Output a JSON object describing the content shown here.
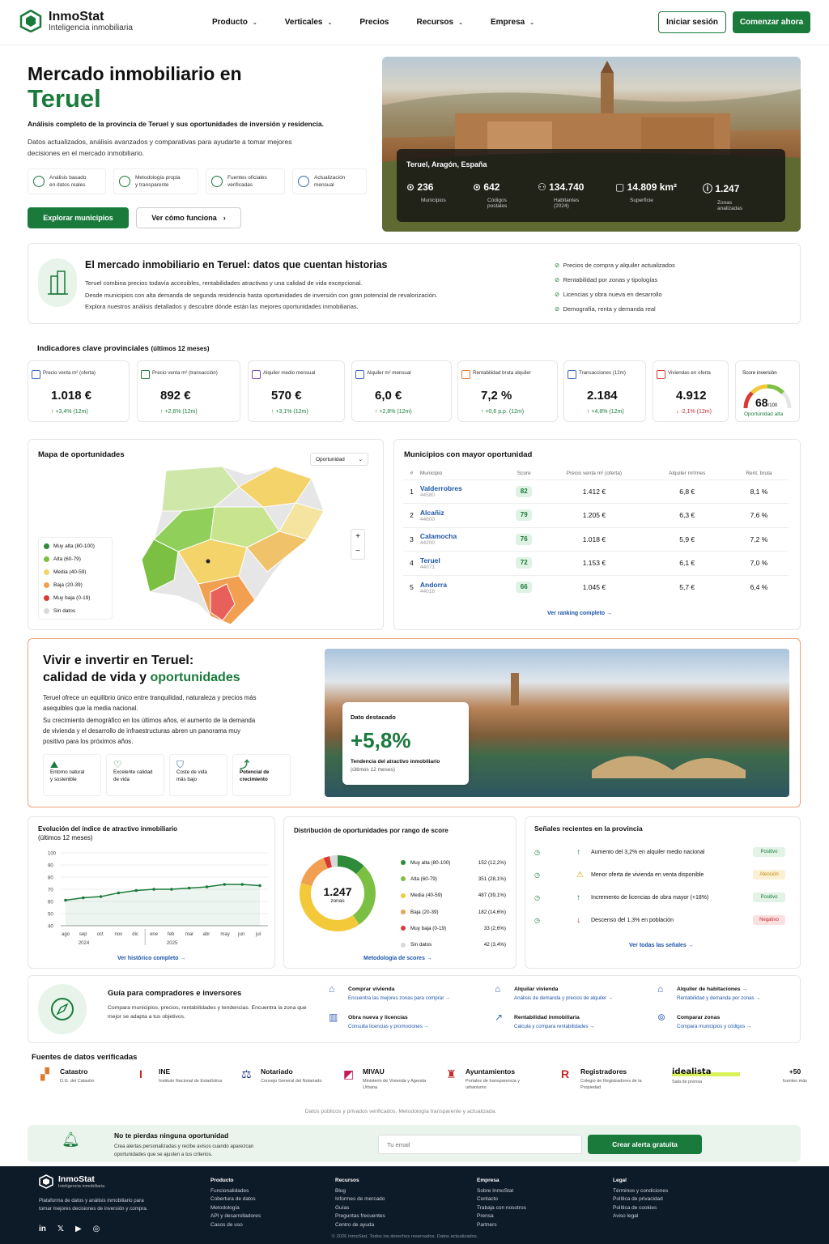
{
  "header": {
    "brand": "InmoStat",
    "tagline": "Inteligencia inmobiliaria",
    "nav": [
      "Producto",
      "Verticales",
      "Precios",
      "Recursos",
      "Empresa"
    ],
    "login": "Iniciar sesión",
    "cta": "Comenzar ahora"
  },
  "hero": {
    "title_line1": "Mercado inmobiliario en",
    "title_line2": "Teruel",
    "lead": "Análisis completo de la provincia de Teruel y sus oportunidades de inversión y residencia.",
    "desc": "Datos actualizados, análisis avanzados y comparativas para ayudarte a tomar mejores decisiones en el mercado inmobiliario.",
    "features": [
      {
        "t1": "Análisis basado",
        "t2": "en datos reales"
      },
      {
        "t1": "Metodología propia",
        "t2": "y transparente"
      },
      {
        "t1": "Fuentes oficiales",
        "t2": "verificadas"
      },
      {
        "t1": "Actualización",
        "t2": "mensual"
      }
    ],
    "btn_primary": "Explorar municipios",
    "btn_secondary": "Ver cómo funciona",
    "location": "Teruel, Aragón, España",
    "stats": [
      {
        "v": "236",
        "l": "Municipios"
      },
      {
        "v": "642",
        "l": "Códigos postales"
      },
      {
        "v": "134.740",
        "l": "Habitantes (2024)"
      },
      {
        "v": "14.809 km²",
        "l": "Superficie"
      },
      {
        "v": "1.247",
        "l": "Zonas analizadas"
      }
    ]
  },
  "intro": {
    "title": "El mercado inmobiliario en Teruel: datos que cuentan historias",
    "p1": "Teruel combina precios todavía accesibles, rentabilidades atractivas y una calidad de vida excepcional.",
    "p2": "Desde municipios con alta demanda de segunda residencia hasta oportunidades de inversión con gran potencial de revalorización.",
    "p3": "Explora nuestros análisis detallados y descubre dónde están las mejores oportunidades inmobiliarias.",
    "checks": [
      "Precios de compra y alquiler actualizados",
      "Rentabilidad por zonas y tipologías",
      "Licencias y obra nueva en desarrollo",
      "Demografía, renta y demanda real"
    ]
  },
  "kpis": {
    "title": "Indicadores clave provinciales",
    "period": "(últimos 12 meses)",
    "items": [
      {
        "t": "Precio venta m² (oferta)",
        "v": "1.018 €",
        "c": "↑ +3,4% (12m)"
      },
      {
        "t": "Precio venta m² (transacción)",
        "v": "892 €",
        "c": "↑ +2,6% (12m)"
      },
      {
        "t": "Alquiler medio mensual",
        "v": "570 €",
        "c": "↑ +3,1% (12m)"
      },
      {
        "t": "Alquiler m² mensual",
        "v": "6,0 €",
        "c": "↑ +2,8% (12m)"
      },
      {
        "t": "Rentabilidad bruta alquiler",
        "v": "7,2 %",
        "c": "↑ +0,6 p.p. (12m)"
      },
      {
        "t": "Transacciones (12m)",
        "v": "2.184",
        "c": "↑ +4,8% (12m)"
      },
      {
        "t": "Viviendas en oferta",
        "v": "4.912",
        "c": "↓ -2,1% (12m)"
      }
    ],
    "score_title": "Score inversión",
    "score": "68",
    "score_max": "/100",
    "score_label": "Oportunidad alta"
  },
  "map": {
    "title": "Mapa de oportunidades",
    "select": "Oportunidad",
    "legend": [
      "Muy alta (80-100)",
      "Alta (60-79)",
      "Media (40-59)",
      "Baja (20-39)",
      "Muy baja (0-19)",
      "Sin datos"
    ],
    "legend_colors": [
      "#2e8b3a",
      "#7cc043",
      "#f3d36a",
      "#f0a050",
      "#d93a35",
      "#d9d9d9"
    ]
  },
  "ranking": {
    "title": "Municipios con mayor oportunidad",
    "cols": [
      "#",
      "Municipio",
      "Score",
      "Precio venta m² (oferta)",
      "Alquiler m²/mes",
      "Rent. bruta"
    ],
    "rows": [
      {
        "n": "1",
        "name": "Valderrobres",
        "zip": "44580",
        "score": "82",
        "price": "1.412 €",
        "rent": "6,8 €",
        "yield": "8,1 %"
      },
      {
        "n": "2",
        "name": "Alcañiz",
        "zip": "44600",
        "score": "79",
        "price": "1.205 €",
        "rent": "6,3 €",
        "yield": "7,6 %"
      },
      {
        "n": "3",
        "name": "Calamocha",
        "zip": "44200",
        "score": "76",
        "price": "1.018 €",
        "rent": "5,9 €",
        "yield": "7,2 %"
      },
      {
        "n": "4",
        "name": "Teruel",
        "zip": "44071",
        "score": "72",
        "price": "1.153 €",
        "rent": "6,1 €",
        "yield": "7,0 %"
      },
      {
        "n": "5",
        "name": "Andorra",
        "zip": "44018",
        "score": "66",
        "price": "1.045 €",
        "rent": "5,7 €",
        "yield": "6,4 %"
      }
    ],
    "link": "Ver ranking completo →"
  },
  "live": {
    "title1": "Vivir e invertir en Teruel:",
    "title2a": "calidad de vida y ",
    "title2b": "oportunidades",
    "p1": "Teruel ofrece un equilibrio único entre tranquilidad, naturaleza y precios más asequibles que la media nacional.",
    "p2": "Su crecimiento demográfico en los últimos años, el aumento de la demanda de vivienda y el desarrollo de infraestructuras abren un panorama muy positivo para los próximos años.",
    "tiles": [
      {
        "a": "Entorno natural",
        "b": "y sostenible"
      },
      {
        "a": "Excelente calidad",
        "b": "de vida"
      },
      {
        "a": "Coste de vida",
        "b": "más bajo"
      },
      {
        "a": "Potencial de",
        "b": "crecimiento"
      }
    ],
    "highlight_label": "Dato destacado",
    "highlight_value": "+5,8%",
    "highlight_desc": "Tendencia del atractivo inmobiliario",
    "highlight_period": "(últimos 12 meses)"
  },
  "chart_data": [
    {
      "type": "line",
      "title": "Evolución del índice de atractivo inmobiliario",
      "subtitle": "(últimos 12 meses)",
      "x": [
        "ago",
        "sep",
        "oct",
        "nov",
        "dic",
        "ene",
        "feb",
        "mar",
        "abr",
        "may",
        "jun",
        "jul"
      ],
      "year_labels": [
        "2024",
        "2025"
      ],
      "values": [
        61,
        63,
        64,
        67,
        69,
        70,
        70,
        71,
        72,
        74,
        74,
        73
      ],
      "ylim": [
        40,
        100
      ],
      "yticks": [
        100,
        90,
        80,
        70,
        60,
        50,
        40
      ],
      "link": "Ver histórico completo →"
    },
    {
      "type": "pie",
      "title": "Distribución de oportunidades por rango de score",
      "center_value": "1.247",
      "center_label": "zonas",
      "labels": [
        "Muy alta (80-100)",
        "Alta (60-79)",
        "Media (40-59)",
        "Baja (20-39)",
        "Muy baja (0-19)",
        "Sin datos"
      ],
      "counts": [
        "152 (12,2%)",
        "351 (28,1%)",
        "487 (39,1%)",
        "182 (14,6%)",
        "33 (2,6%)",
        "42 (3,4%)"
      ],
      "values": [
        12.2,
        28.1,
        39.1,
        14.6,
        2.6,
        3.4
      ],
      "colors": [
        "#2e8b3a",
        "#7cc043",
        "#f3c93a",
        "#f0a050",
        "#d93a35",
        "#d9d9d9"
      ],
      "link": "Metodología de scores →"
    }
  ],
  "signals": {
    "title": "Señales recientes en la provincia",
    "items": [
      {
        "t": "Aumento del 3,2% en alquiler medio nacional",
        "b": "Positivo",
        "c": "#1a7a3c",
        "bg": "#e2f3e6",
        "ic": "↑",
        "icc": "#1a7a3c"
      },
      {
        "t": "Menor oferta de vivienda en venta disponible",
        "b": "Atención",
        "c": "#c28a00",
        "bg": "#fbf0d4",
        "ic": "⚠",
        "icc": "#e0a800"
      },
      {
        "t": "Incremento de licencias de obra mayor (+18%)",
        "b": "Positivo",
        "c": "#1a7a3c",
        "bg": "#e2f3e6",
        "ic": "↑",
        "icc": "#1a7a3c"
      },
      {
        "t": "Descenso del 1,3% en población",
        "b": "Negativo",
        "c": "#c62828",
        "bg": "#fbe0e0",
        "ic": "↓",
        "icc": "#c62828"
      }
    ],
    "link": "Ver todas las señales →"
  },
  "guide": {
    "title": "Guía para compradores e inversores",
    "desc": "Compara municipios, precios, rentabilidades y tendencias. Encuentra la zona que mejor se adapta a tus objetivos.",
    "items": [
      {
        "a": "Comprar vivienda",
        "b": "Encuentra las mejores zonas para comprar →"
      },
      {
        "a": "Alquilar vivienda",
        "b": "Análisis de demanda y precios de alquiler →"
      },
      {
        "a": "Alquiler de habitaciones →",
        "b": "Rentabilidad y demanda por zonas →"
      },
      {
        "a": "Obra nueva y licencias",
        "b": "Consulta licencias y promociones →"
      },
      {
        "a": "Rentabilidad inmobiliaria",
        "b": "Calcula y compara rentabilidades →"
      },
      {
        "a": "Comparar zonas",
        "b": "Compara municipios y códigos →"
      }
    ]
  },
  "sources": {
    "title": "Fuentes de datos verificadas",
    "items": [
      {
        "n": "Catastro",
        "d": "D.G. del Catastro"
      },
      {
        "n": "INE",
        "d": "Instituto Nacional de Estadística"
      },
      {
        "n": "Notariado",
        "d": "Consejo General del Notariado"
      },
      {
        "n": "MIVAU",
        "d": "Ministerio de Vivienda y Agenda Urbana"
      },
      {
        "n": "Ayuntamientos",
        "d": "Portales de transparencia y urbanismo"
      },
      {
        "n": "Registradores",
        "d": "Colegio de Registradores de la Propiedad"
      },
      {
        "n": "idealista",
        "d": "Sala de prensa"
      },
      {
        "n": "+50",
        "d": "fuentes más"
      }
    ],
    "note": "Datos públicos y privados verificados. Metodología transparente y actualizada."
  },
  "alert": {
    "title": "No te pierdas ninguna oportunidad",
    "desc": "Crea alertas personalizadas y recibe avisos cuando aparezcan oportunidades que se ajusten a tus criterios.",
    "placeholder": "Tu email",
    "btn": "Crear alerta gratuita"
  },
  "footer": {
    "brand": "InmoStat",
    "tagline": "Inteligencia inmobiliaria",
    "desc": "Plataforma de datos y análisis inmobiliario para tomar mejores decisiones de inversión y compra.",
    "cols": [
      {
        "h": "Producto",
        "l": [
          "Funcionalidades",
          "Cobertura de datos",
          "Metodología",
          "API y desarrolladores",
          "Casos de uso"
        ]
      },
      {
        "h": "Recursos",
        "l": [
          "Blog",
          "Informes de mercado",
          "Guías",
          "Preguntas frecuentes",
          "Centro de ayuda"
        ]
      },
      {
        "h": "Empresa",
        "l": [
          "Sobre InmoStat",
          "Contacto",
          "Trabaja con nosotros",
          "Prensa",
          "Partners"
        ]
      },
      {
        "h": "Legal",
        "l": [
          "Términos y condiciones",
          "Política de privacidad",
          "Política de cookies",
          "Aviso legal"
        ]
      }
    ],
    "copy": "© 2026 InmoStat. Todos los derechos reservados. Datos actualizados."
  }
}
